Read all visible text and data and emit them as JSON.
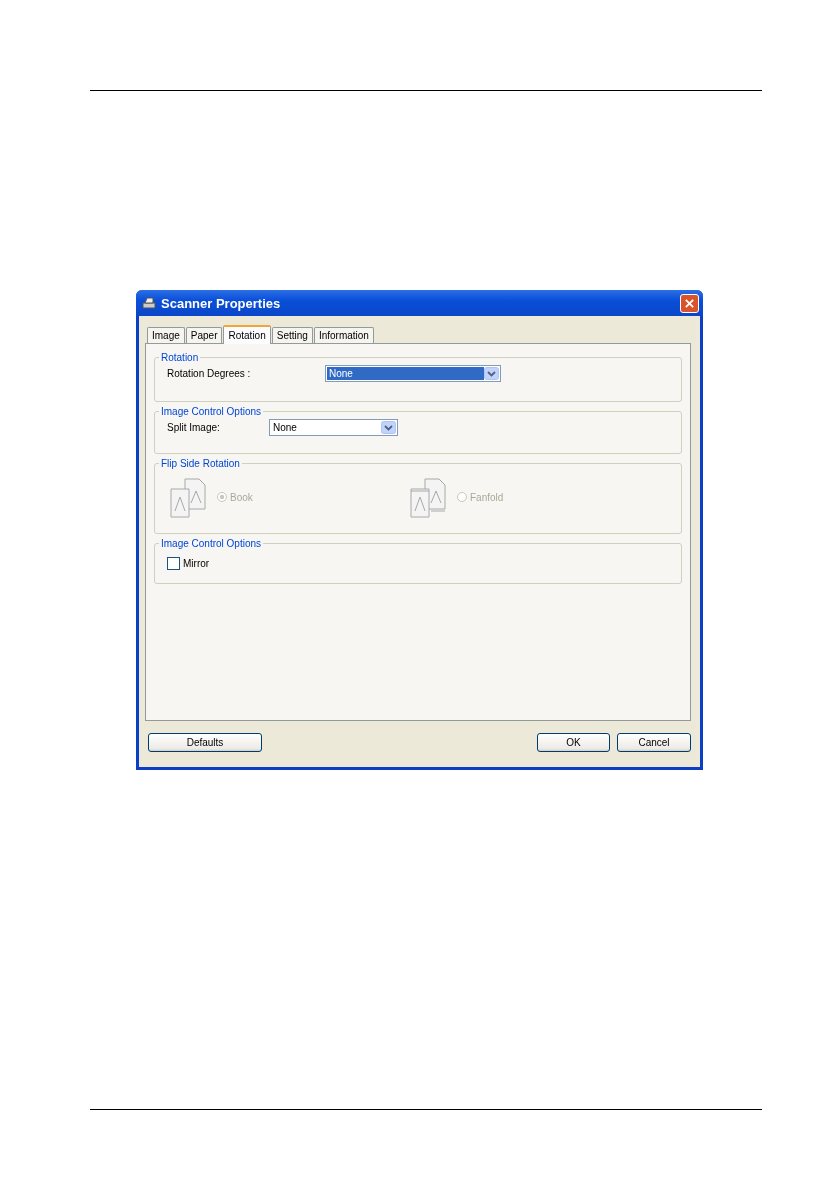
{
  "window": {
    "title": "Scanner Properties"
  },
  "tabs": [
    {
      "label": "Image",
      "selected": false
    },
    {
      "label": "Paper",
      "selected": false
    },
    {
      "label": "Rotation",
      "selected": true
    },
    {
      "label": "Setting",
      "selected": false
    },
    {
      "label": "Information",
      "selected": false
    }
  ],
  "groups": [
    {
      "kind": "dropdown",
      "title": "Rotation",
      "label": "Rotation Degrees :",
      "value": "None",
      "focused": true
    },
    {
      "kind": "dropdown",
      "title": "Image Control Options",
      "label": "Split Image:",
      "value": "None",
      "focused": false
    },
    {
      "kind": "radios",
      "title": "Flip Side Rotation",
      "disabled": true,
      "options": [
        {
          "label": "Book",
          "selected": true
        },
        {
          "label": "Fanfold",
          "selected": false
        }
      ]
    },
    {
      "kind": "checkbox",
      "title": "Image Control Options",
      "label": "Mirror",
      "checked": false
    }
  ],
  "buttons": [
    {
      "label": "Defaults"
    },
    {
      "label": "OK"
    },
    {
      "label": "Cancel"
    }
  ]
}
